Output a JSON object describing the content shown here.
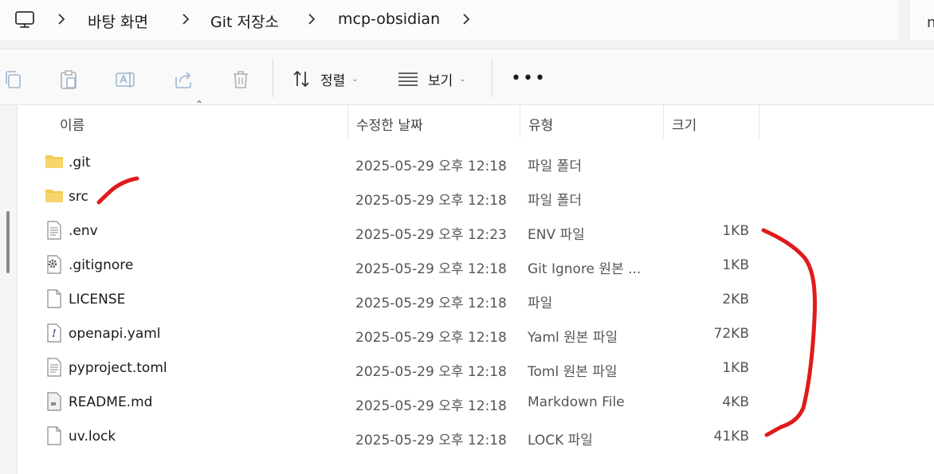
{
  "breadcrumb": {
    "items": [
      "바탕 화면",
      "Git 저장소",
      "mcp-obsidian"
    ],
    "root_icon": "monitor-icon",
    "search_partial": "n"
  },
  "toolbar": {
    "icons": [
      "copy-icon",
      "paste-icon",
      "rename-icon",
      "share-icon",
      "delete-icon"
    ],
    "sort_label": "정렬",
    "view_label": "보기",
    "more_label": "•••"
  },
  "columns": {
    "name": "이름",
    "date": "수정한 날짜",
    "type": "유형",
    "size": "크기"
  },
  "files": [
    {
      "name": ".git",
      "date": "2025-05-29 오후 12:18",
      "type": "파일 폴더",
      "size": "",
      "icon": "folder-icon"
    },
    {
      "name": "src",
      "date": "2025-05-29 오후 12:18",
      "type": "파일 폴더",
      "size": "",
      "icon": "folder-icon"
    },
    {
      "name": ".env",
      "date": "2025-05-29 오후 12:23",
      "type": "ENV 파일",
      "size": "1KB",
      "icon": "text-file-icon"
    },
    {
      "name": ".gitignore",
      "date": "2025-05-29 오후 12:18",
      "type": "Git Ignore 원본 ...",
      "size": "1KB",
      "icon": "settings-file-icon"
    },
    {
      "name": "LICENSE",
      "date": "2025-05-29 오후 12:18",
      "type": "파일",
      "size": "2KB",
      "icon": "blank-file-icon"
    },
    {
      "name": "openapi.yaml",
      "date": "2025-05-29 오후 12:18",
      "type": "Yaml 원본 파일",
      "size": "72KB",
      "icon": "yaml-file-icon"
    },
    {
      "name": "pyproject.toml",
      "date": "2025-05-29 오후 12:18",
      "type": "Toml 원본 파일",
      "size": "1KB",
      "icon": "text-file-icon"
    },
    {
      "name": "README.md",
      "date": "2025-05-29 오후 12:18",
      "type": "Markdown File",
      "size": "4KB",
      "icon": "markdown-file-icon"
    },
    {
      "name": "uv.lock",
      "date": "2025-05-29 오후 12:18",
      "type": "LOCK 파일",
      "size": "41KB",
      "icon": "blank-file-icon"
    }
  ],
  "colors": {
    "annotation": "#e01b1b",
    "folder": "#f2c94c"
  }
}
